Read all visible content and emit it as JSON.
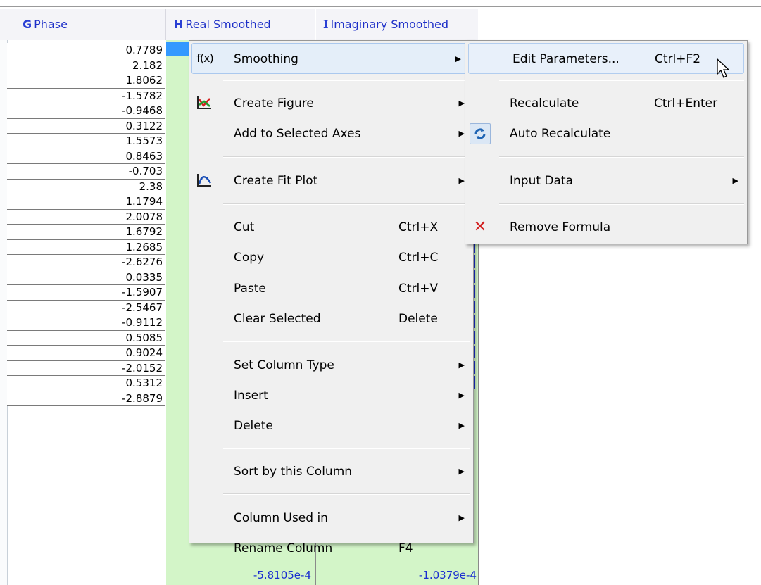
{
  "columns": {
    "g": {
      "letter": "G",
      "name": "Phase"
    },
    "h": {
      "letter": "H",
      "name": "Real Smoothed"
    },
    "i": {
      "letter": "I",
      "name": "Imaginary Smoothed"
    }
  },
  "phase_values": [
    "0.7789",
    "2.182",
    "1.8062",
    "-1.5782",
    "-0.9468",
    "0.3122",
    "1.5573",
    "0.8463",
    "-0.703",
    "2.38",
    "1.1794",
    "2.0078",
    "1.6792",
    "1.2685",
    "-2.6276",
    "0.0335",
    "-1.5907",
    "-2.5467",
    "-0.9112",
    "0.5085",
    "0.9024",
    "-2.0152",
    "0.5312",
    "-2.8879"
  ],
  "last_row": {
    "real": "-5.8105e-4",
    "imaginary": "-1.0379e-4"
  },
  "context_menu": {
    "smoothing": {
      "icon": "f(x)",
      "label": "Smoothing"
    },
    "create_figure": "Create Figure",
    "add_to_selected_axes": "Add to Selected Axes",
    "create_fit_plot": "Create Fit Plot",
    "cut": {
      "label": "Cut",
      "shortcut": "Ctrl+X"
    },
    "copy": {
      "label": "Copy",
      "shortcut": "Ctrl+C"
    },
    "paste": {
      "label": "Paste",
      "shortcut": "Ctrl+V"
    },
    "clear_selected": {
      "label": "Clear Selected",
      "shortcut": "Delete"
    },
    "set_column_type": "Set Column Type",
    "insert": "Insert",
    "delete": "Delete",
    "sort_by_column": "Sort by this Column",
    "column_used_in": "Column Used in",
    "rename_column": {
      "label": "Rename Column",
      "shortcut": "F4"
    }
  },
  "submenu": {
    "edit_parameters": {
      "label": "Edit Parameters...",
      "shortcut": "Ctrl+F2"
    },
    "recalculate": {
      "label": "Recalculate",
      "shortcut": "Ctrl+Enter"
    },
    "auto_recalculate": "Auto Recalculate",
    "input_data": "Input Data",
    "remove_formula": "Remove Formula"
  },
  "colors": {
    "header_text": "#1e30c8",
    "cell_fill": "#d3f5c8",
    "highlight": "#e4eef9",
    "remove_icon": "#d21d1d"
  }
}
